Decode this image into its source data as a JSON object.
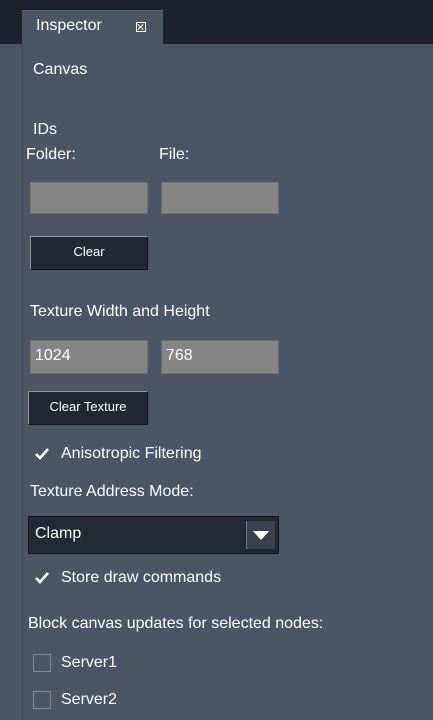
{
  "tab": {
    "title": "Inspector"
  },
  "section": {
    "title": "Canvas"
  },
  "ids": {
    "heading": "IDs",
    "folder_label": "Folder:",
    "file_label": "File:",
    "folder_value": "",
    "file_value": "",
    "clear_label": "Clear"
  },
  "texture": {
    "heading": "Texture Width and Height",
    "width": "1024",
    "height": "768",
    "clear_texture_label": "Clear Texture"
  },
  "anisotropic": {
    "label": "Anisotropic Filtering",
    "checked": true
  },
  "address_mode": {
    "label": "Texture Address Mode:",
    "value": "Clamp"
  },
  "store_draw": {
    "label": "Store draw commands",
    "checked": true
  },
  "block_updates": {
    "label": "Block canvas updates for selected nodes:",
    "nodes": [
      {
        "name": "Server1",
        "checked": false
      },
      {
        "name": "Server2",
        "checked": false
      }
    ]
  },
  "colors": {
    "panel": "#4a5566",
    "tabbar": "#1d232c",
    "field": "#858585",
    "button": "#222831"
  }
}
